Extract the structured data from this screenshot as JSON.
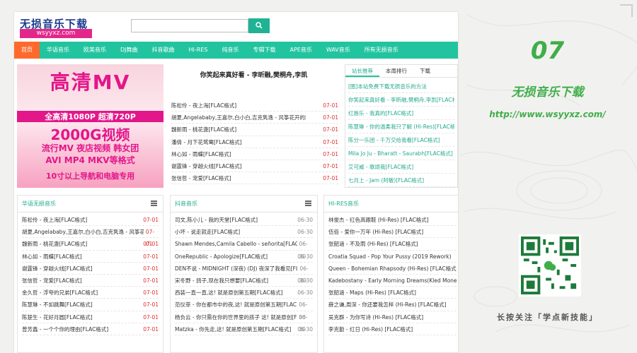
{
  "site": {
    "logo": "无损音乐下载",
    "logo_sub": "wsyyxz.com",
    "search_placeholder": "",
    "search_icon": "search-icon"
  },
  "nav": [
    "首页",
    "华语音乐",
    "欧美音乐",
    "DJ舞曲",
    "抖音歌曲",
    "HI-RES",
    "纯音乐",
    "专辑下载",
    "APE音乐",
    "WAV音乐",
    "所有无损音乐"
  ],
  "banner": {
    "line1": "高清MV",
    "line2": "全高清1080P  超清720P",
    "line3": "2000G视频",
    "line4": "流行MV 夜店视频 韩女团",
    "line5": "AVI MP4 MKV等格式",
    "line6": "10寸以上导航和电脑专用"
  },
  "hot": {
    "title": "你笑起来真好看 - 李昕融,樊桐舟,李凯",
    "items": [
      {
        "t": "陈松伶 - 夜上海[FLAC格式]",
        "d": "07-01"
      },
      {
        "t": "胡夏,Angelababy,王嘉尔,白小白,吉克隽逸 - 风筝花开的路口[FLAC格式]",
        "d": "07-01"
      },
      {
        "t": "魏新雨 - 桃花盏[FLAC格式]",
        "d": "07-01"
      },
      {
        "t": "潘倩 - 月下花鸳鸯[FLAC格式]",
        "d": "07-01"
      },
      {
        "t": "林心如 - 雨蝶[FLAC格式]",
        "d": "07-01"
      },
      {
        "t": "谢霆锋 - 穿越火线[FLAC格式]",
        "d": "07-01"
      },
      {
        "t": "张信哲 - 宠爱[FLAC格式]",
        "d": "07-01"
      }
    ]
  },
  "tabs": {
    "labels": [
      "站长推荐",
      "本周排行",
      "下载"
    ],
    "items": [
      "[图]本站免费下载无损音乐的方法",
      "你笑起来真好看 - 李昕融,樊桐舟,李凯[FLAC格式]",
      "红唇乐 - 我真的[FLAC格式]",
      "陈慧琳 - 你的温柔我只了解 (Hi-Res)[FLAC格式]",
      "陈分一乐团 - 千万交给我看[FLAC格式]",
      "Mila Jo Ju - Bharatt - Saurabh[FLAC格式]",
      "艾可威 - 歌颂我[FLAC格式]",
      "七月上 - Jam (阿敏)[FLAC格式]"
    ]
  },
  "columns": [
    {
      "title": "华语无损音乐",
      "items": [
        {
          "t": "陈松伶 - 夜上海[FLAC格式]",
          "d": "07-01"
        },
        {
          "t": "胡夏,Angelababy,王嘉尔,白小白,吉克隽逸 - 风筝花开[FLAC]",
          "d": "07-01"
        },
        {
          "t": "魏新雨 - 桃花盏[FLAC格式]",
          "d": "07-01"
        },
        {
          "t": "林心如 - 雨蝶[FLAC格式]",
          "d": "07-01"
        },
        {
          "t": "谢霆锋 - 穿越火线[FLAC格式]",
          "d": "07-01"
        },
        {
          "t": "张信哲 - 宠爱[FLAC格式]",
          "d": "07-01"
        },
        {
          "t": "金久哲 - 浮夸的兄弟[FLAC格式]",
          "d": "07-01"
        },
        {
          "t": "陈慧琳 - 不如跳舞[FLAC格式]",
          "d": "07-01"
        },
        {
          "t": "陈楚生 - 花好月圆[FLAC格式]",
          "d": "07-01"
        },
        {
          "t": "曾芳鑫 - 一个个你的理由[FLAC格式]",
          "d": "07-01"
        }
      ]
    },
    {
      "title": "抖音音乐",
      "items": [
        {
          "t": "司文,陈小儿 - 我的天堂[FLAC格式]",
          "d": "06-30"
        },
        {
          "t": "小坏 - 说走就走[FLAC格式]",
          "d": "06-30"
        },
        {
          "t": "Shawn Mendes,Camila Cabello - señorita[FLAC格式]",
          "d": "06-30"
        },
        {
          "t": "OneRepublic - Apologize[FLAC格式]",
          "d": "06-30"
        },
        {
          "t": "DEN不说 - MIDNIGHT (深夜) (DJ) 夜深了我看见[FLAC格式]",
          "d": "06-30"
        },
        {
          "t": "宋冬野 - 鸽子,现在我只想要[FLAC格式]",
          "d": "06-30"
        },
        {
          "t": "西装一直一直,这! 就是原创第五期[FLAC格式]",
          "d": "06-30"
        },
        {
          "t": "范仪菲 - 你在都市中的夜,这! 就是原创第五期[FLAC格式]",
          "d": "06-30"
        },
        {
          "t": "杨负云 - 你只需在你的世界里的孩子 这! 就是原创[FLAC]",
          "d": "06-30"
        },
        {
          "t": "Matzka - 你先走,这! 就是原创第五期[FLAC格式]",
          "d": "06-30"
        }
      ]
    },
    {
      "title": "HI-RES音乐",
      "items": [
        {
          "t": "林俊杰 - 红色高跟鞋 (Hi-Res) [FLAC格式]",
          "d": ""
        },
        {
          "t": "伍佰 - 爱你一万年 (Hi-Res) [FLAC格式]",
          "d": ""
        },
        {
          "t": "张韶涵 - 不及雨 (Hi-Res) [FLAC格式]",
          "d": ""
        },
        {
          "t": "Croatia Squad - Pop Your Pussy (2019 Rework)",
          "d": ""
        },
        {
          "t": "Queen - Bohemian Rhapsody (Hi-Res) [FLAC格式]",
          "d": ""
        },
        {
          "t": "Kadebostany - Early Morning Dreams(Kled Mone)",
          "d": ""
        },
        {
          "t": "张韶涵 - Maps (Hi-Res) [FLAC格式]",
          "d": ""
        },
        {
          "t": "薛之谦,周深 - 你还要我怎样 (Hi-Res) [FLAC格式]",
          "d": ""
        },
        {
          "t": "吴克群 - 为你写诗 (Hi-Res) [FLAC格式]",
          "d": ""
        },
        {
          "t": "李克勤 - 红日 (Hi-Res) [FLAC格式]",
          "d": ""
        }
      ]
    }
  ],
  "side": {
    "number": "07",
    "title": "无损音乐下载",
    "url": "http://www.wsyyxz.com/",
    "caption": "长按关注「学点新技能」"
  },
  "colors": {
    "accent": "#22c49f",
    "active_nav": "#ff6a2c",
    "date": "#e0302b",
    "side_green": "#3fae49",
    "logo_pink": "#e3278a"
  }
}
